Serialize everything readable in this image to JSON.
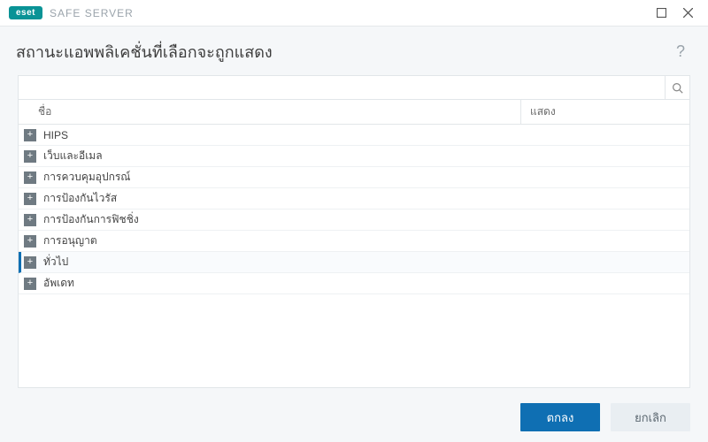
{
  "brand": {
    "badge": "eset",
    "product": "SAFE SERVER"
  },
  "window": {
    "maximize_title": "Maximize",
    "close_title": "Close"
  },
  "page": {
    "title": "สถานะแอพพลิเคชั่นที่เลือกจะถูกแสดง",
    "help": "?"
  },
  "search": {
    "placeholder": ""
  },
  "columns": {
    "name": "ชื่อ",
    "show": "แสดง"
  },
  "rows": [
    {
      "label": "HIPS",
      "selected": false
    },
    {
      "label": "เว็บและอีเมล",
      "selected": false
    },
    {
      "label": "การควบคุมอุปกรณ์",
      "selected": false
    },
    {
      "label": "การป้องกันไวรัส",
      "selected": false
    },
    {
      "label": "การป้องกันการฟิชชิ่ง",
      "selected": false
    },
    {
      "label": "การอนุญาต",
      "selected": false
    },
    {
      "label": "ทั่วไป",
      "selected": true
    },
    {
      "label": "อัพเดท",
      "selected": false
    }
  ],
  "buttons": {
    "ok": "ตกลง",
    "cancel": "ยกเลิก"
  },
  "icons": {
    "expand": "+"
  }
}
